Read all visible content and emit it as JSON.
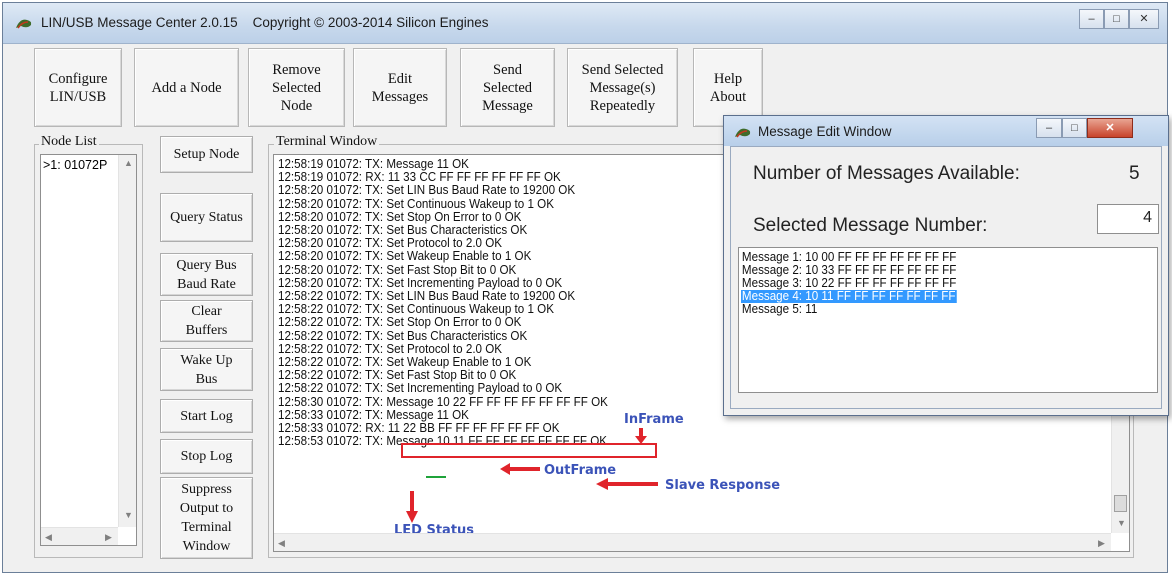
{
  "window": {
    "title": "LIN/USB Message Center 2.0.15",
    "copyright": "Copyright © 2003-2014 Silicon Engines"
  },
  "toolbar": [
    {
      "label": "Configure\nLIN/USB"
    },
    {
      "label": "Add a Node"
    },
    {
      "label": "Remove\nSelected\nNode"
    },
    {
      "label": "Edit\nMessages"
    },
    {
      "label": "Send\nSelected\nMessage"
    },
    {
      "label": "Send Selected\nMessage(s)\nRepeatedly"
    },
    {
      "label": "Help\nAbout"
    }
  ],
  "node_list": {
    "label": "Node List",
    "items": [
      ">1: 01072P"
    ]
  },
  "side_buttons": [
    {
      "label": "Setup Node"
    },
    {
      "label": "Query Status"
    },
    {
      "label": "Query Bus\nBaud Rate"
    },
    {
      "label": "Clear\nBuffers"
    },
    {
      "label": "Wake Up\nBus"
    },
    {
      "label": "Start Log"
    },
    {
      "label": "Stop Log"
    },
    {
      "label": "Suppress\nOutput to\nTerminal\nWindow"
    }
  ],
  "terminal": {
    "label": "Terminal Window",
    "lines": [
      "12:58:19 01072: TX: Message 11 OK",
      "12:58:19 01072: RX: 11 33 CC FF FF FF FF FF FF OK",
      "12:58:20 01072: TX: Set LIN Bus Baud Rate to 19200 OK",
      "12:58:20 01072: TX: Set Continuous Wakeup to 1 OK",
      "12:58:20 01072: TX: Set Stop On Error to 0 OK",
      "12:58:20 01072: TX: Set Bus Characteristics OK",
      "12:58:20 01072: TX: Set Protocol to 2.0 OK",
      "12:58:20 01072: TX: Set Wakeup Enable to 1 OK",
      "12:58:20 01072: TX: Set Fast Stop Bit to 0 OK",
      "12:58:20 01072: TX: Set Incrementing Payload to 0 OK",
      "12:58:22 01072: TX: Set LIN Bus Baud Rate to 19200 OK",
      "12:58:22 01072: TX: Set Continuous Wakeup to 1 OK",
      "12:58:22 01072: TX: Set Stop On Error to 0 OK",
      "12:58:22 01072: TX: Set Bus Characteristics OK",
      "12:58:22 01072: TX: Set Protocol to 2.0 OK",
      "12:58:22 01072: TX: Set Wakeup Enable to 1 OK",
      "12:58:22 01072: TX: Set Fast Stop Bit to 0 OK",
      "12:58:22 01072: TX: Set Incrementing Payload to 0 OK",
      "12:58:30 01072: TX: Message 10 22 FF FF FF FF FF FF FF OK",
      "12:58:33 01072: TX: Message 11 OK",
      "12:58:33 01072: RX: 11 22 BB FF FF FF FF FF FF OK",
      "12:58:53 01072: TX: Message 10 11 FF FF FF FF FF FF FF OK"
    ]
  },
  "annotations": {
    "inframe": "InFrame",
    "outframe": "OutFrame",
    "slave_response": "Slave Response",
    "led_status": "LED Status",
    "color": "#3b53b8",
    "highlight_color": "#e0242b"
  },
  "edit_window": {
    "title": "Message Edit Window",
    "available_label": "Number of Messages Available:",
    "available_value": "5",
    "selected_label": "Selected Message Number:",
    "selected_value": "4",
    "messages": [
      "Message 1: 10 00 FF FF FF FF FF FF FF",
      "Message 2: 10 33 FF FF FF FF FF FF FF",
      "Message 3: 10 22 FF FF FF FF FF FF FF",
      "Message 4: 10 11 FF FF FF FF FF FF FF",
      "Message 5: 11"
    ],
    "selected_index": 3
  }
}
